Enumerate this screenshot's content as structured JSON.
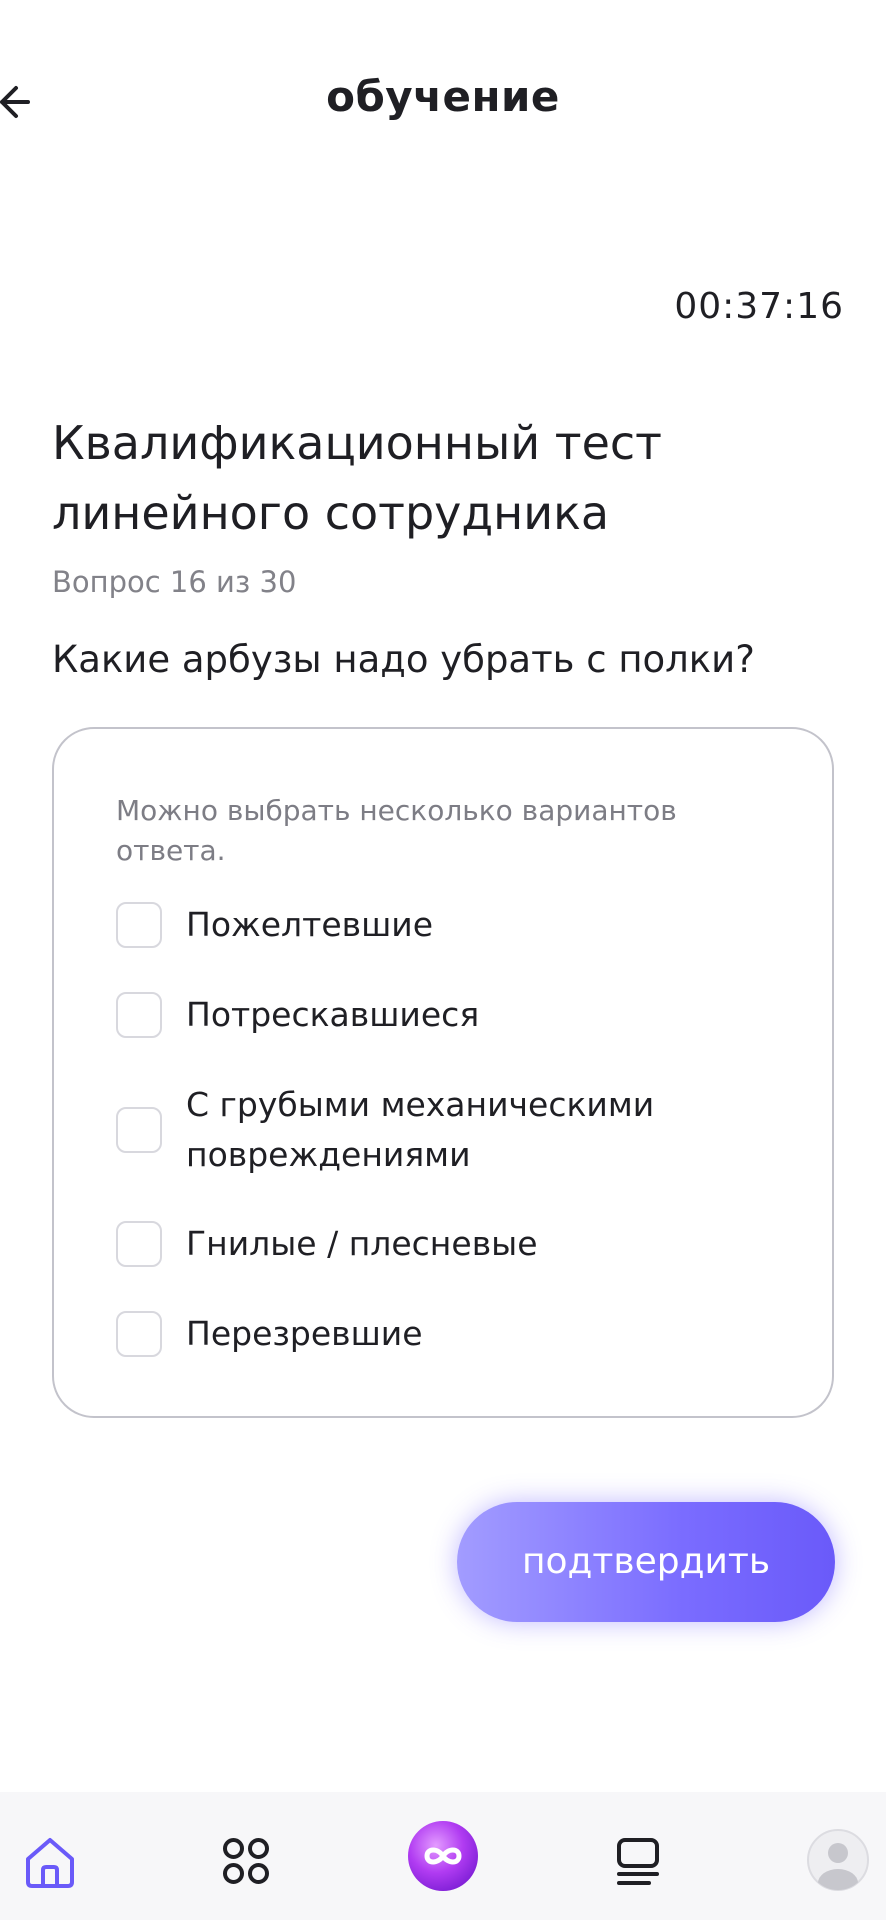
{
  "header": {
    "title": "обучение",
    "back_icon": "arrow-left-icon"
  },
  "timer": "00:37:16",
  "test": {
    "title": "Квалификационный тест линейного сотрудника",
    "counter": "Вопрос 16 из 30",
    "question": "Какие арбузы надо убрать с полки?"
  },
  "answers": {
    "hint": "Можно выбрать несколько вариантов ответа.",
    "options": [
      {
        "label": "Пожелтевшие",
        "checked": false
      },
      {
        "label": "Потрескавшиеся",
        "checked": false
      },
      {
        "label": "С грубыми механическими повреждениями",
        "checked": false
      },
      {
        "label": "Гнилые / плесневые",
        "checked": false
      },
      {
        "label": "Перезревшие",
        "checked": false
      }
    ]
  },
  "confirm_label": "подтвердить",
  "nav": {
    "items": [
      {
        "icon": "home-icon",
        "active": true
      },
      {
        "icon": "grid-icon",
        "active": false
      },
      {
        "icon": "infinity-icon",
        "active": false
      },
      {
        "icon": "list-icon",
        "active": false
      },
      {
        "icon": "profile-icon",
        "active": false
      }
    ]
  },
  "colors": {
    "accent": "#6a5af9",
    "text": "#1f1f24",
    "muted": "#828289"
  }
}
